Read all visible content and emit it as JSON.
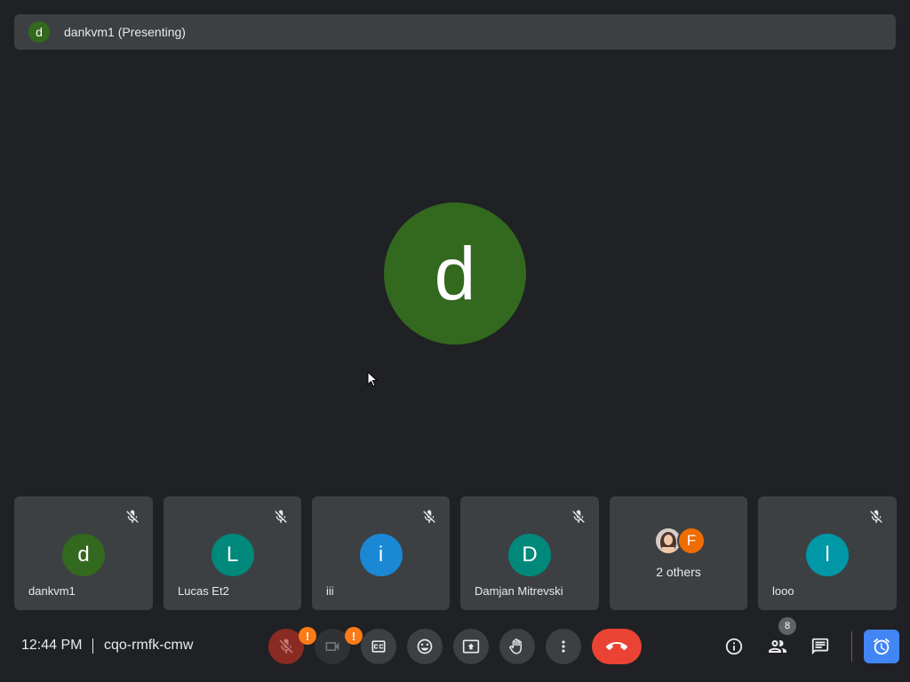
{
  "presenter_bar": {
    "avatar_letter": "d",
    "title": "dankvm1 (Presenting)"
  },
  "main": {
    "avatar_letter": "d"
  },
  "tiles": [
    {
      "name": "dankvm1",
      "letter": "d",
      "color": "#33691e",
      "muted": true
    },
    {
      "name": "Lucas Et2",
      "letter": "L",
      "color": "#00897b",
      "muted": true
    },
    {
      "name": "iii",
      "letter": "i",
      "color": "#1a88d4",
      "muted": true
    },
    {
      "name": "Damjan Mitrevski",
      "letter": "D",
      "color": "#00897b",
      "muted": true
    },
    {
      "others_label": "2 others",
      "letter": "F",
      "color": "#ef6c00"
    },
    {
      "name": "looo",
      "letter": "l",
      "color": "#0097a7",
      "muted": true
    }
  ],
  "bottom": {
    "time": "12:44 PM",
    "meeting_code": "cqo-rmfk-cmw",
    "mic_badge": "!",
    "camera_badge": "!",
    "participant_count": "8"
  },
  "icons": [
    "mic-off-icon",
    "videocam-off-icon",
    "captions-icon",
    "emoji-icon",
    "present-screen-icon",
    "raise-hand-icon",
    "more-icon",
    "call-end-icon",
    "info-icon",
    "people-icon",
    "chat-icon",
    "alarm-icon"
  ],
  "colors": {
    "background": "#202124",
    "surface": "#3c4043",
    "danger": "#ea4335",
    "warning": "#fa7b17",
    "accent": "#4285f4"
  }
}
